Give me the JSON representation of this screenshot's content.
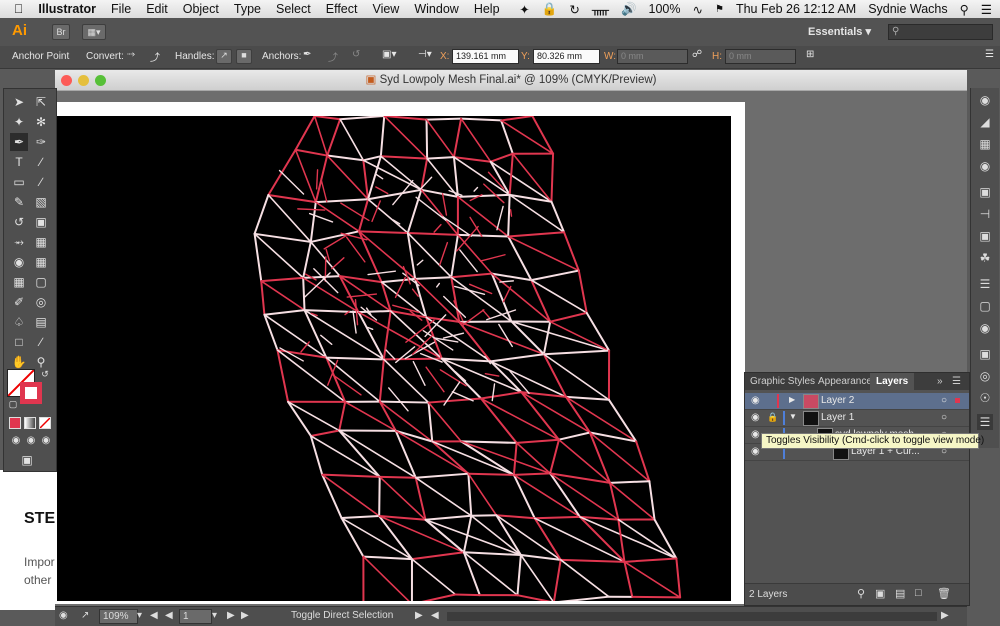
{
  "menubar": {
    "app": "Illustrator",
    "items": [
      "File",
      "Edit",
      "Object",
      "Type",
      "Select",
      "Effect",
      "View",
      "Window",
      "Help"
    ],
    "battery": "100%",
    "datetime": "Thu Feb 26  12:12 AM",
    "user": "Sydnie Wachs"
  },
  "appbar": {
    "logo": "Ai",
    "bridge": "Br",
    "workspace": "Essentials"
  },
  "controlbar": {
    "tool_name": "Anchor Point",
    "convert_label": "Convert:",
    "handles_label": "Handles:",
    "anchors_label": "Anchors:",
    "x_label": "X:",
    "x_value": "139.161 mm",
    "y_label": "Y:",
    "y_value": "80.326 mm",
    "w_label": "W:",
    "w_value": "0 mm",
    "h_label": "H:",
    "h_value": "0 mm"
  },
  "document": {
    "title": "Syd Lowpoly Mesh Final.ai* @ 109% (CMYK/Preview)",
    "mesh_color": "#e0364f",
    "mesh_highlight": "#f6dfe3"
  },
  "layers_panel": {
    "tabs": [
      "Graphic Styles",
      "Appearance",
      "Layers"
    ],
    "active_tab": "Layers",
    "rows": [
      {
        "name": "Layer 2"
      },
      {
        "name": "Layer 1"
      },
      {
        "name": "syd lowpoly mesh"
      },
      {
        "name": "Layer 1 + Cur..."
      }
    ],
    "count": "2 Layers",
    "tooltip": "Toggles Visibility (Cmd-click to toggle view mode)"
  },
  "statusbar": {
    "zoom": "109%",
    "artboard": "1",
    "status": "Toggle Direct Selection"
  },
  "browser_page": {
    "heading": "STE",
    "line1": "Impor",
    "line2": "other"
  }
}
